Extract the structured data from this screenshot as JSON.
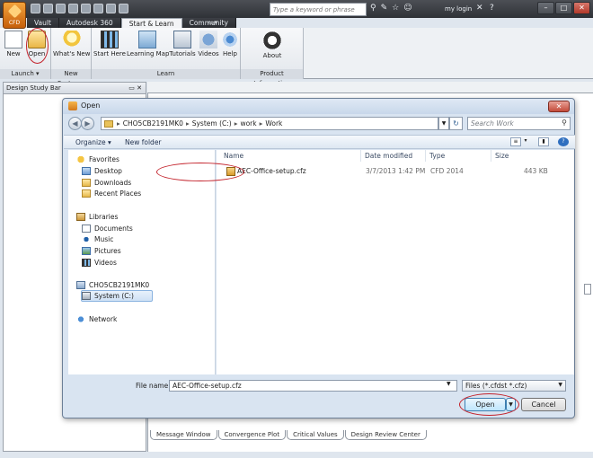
{
  "app": {
    "app_button_label": "CFD",
    "search_placeholder": "Type a keyword or phrase",
    "login_label": "my login",
    "ribbon_tabs": [
      "Vault",
      "Autodesk 360",
      "Start & Learn",
      "Community"
    ],
    "active_tab_index": 2
  },
  "ribbon": {
    "groups": [
      {
        "label": "Launch",
        "buttons": [
          "New",
          "Open"
        ]
      },
      {
        "label": "New Features",
        "buttons": [
          "What's New"
        ]
      },
      {
        "label": "Learn",
        "buttons": [
          "Start Here",
          "Learning Map",
          "Tutorials",
          "Videos",
          "Help"
        ]
      },
      {
        "label": "Product Information",
        "buttons": [
          "About"
        ]
      }
    ]
  },
  "left_panel": {
    "title": "Design Study Bar"
  },
  "bottom_tabs": [
    "Message Window",
    "Convergence Plot",
    "Critical Values",
    "Design Review Center"
  ],
  "dialog": {
    "title": "Open",
    "address": [
      "CHO5CB2191MK0",
      "System (C:)",
      "work",
      "Work"
    ],
    "search_placeholder": "Search Work",
    "organize_label": "Organize",
    "new_folder_label": "New folder",
    "nav": {
      "favorites": "Favorites",
      "desktop": "Desktop",
      "downloads": "Downloads",
      "recent": "Recent Places",
      "libraries": "Libraries",
      "documents": "Documents",
      "music": "Music",
      "pictures": "Pictures",
      "videos": "Videos",
      "computer": "CHO5CB2191MK0",
      "drive": "System (C:)",
      "network": "Network"
    },
    "columns": [
      "Name",
      "Date modified",
      "Type",
      "Size"
    ],
    "files": [
      {
        "name": "AEC-Office-setup.cfz",
        "date": "3/7/2013 1:42 PM",
        "type": "CFD 2014",
        "size": "443 KB"
      }
    ],
    "file_name_label": "File name:",
    "file_name_value": "AEC-Office-setup.cfz",
    "file_type_value": "Files (*.cfdst *.cfz)",
    "open_label": "Open",
    "cancel_label": "Cancel"
  }
}
